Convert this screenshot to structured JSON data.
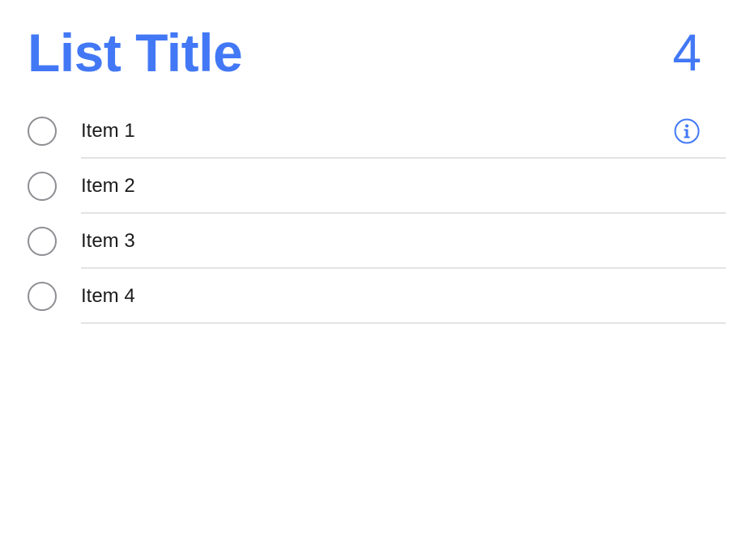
{
  "colors": {
    "accent": "#4278f5",
    "label": "#1c1c1e",
    "checkbox_border": "#8e8e93",
    "divider": "#e3e3e6"
  },
  "header": {
    "title": "List Title",
    "count": "4"
  },
  "items": [
    {
      "label": "Item 1",
      "completed": false,
      "selected": true
    },
    {
      "label": "Item 2",
      "completed": false,
      "selected": false
    },
    {
      "label": "Item 3",
      "completed": false,
      "selected": false
    },
    {
      "label": "Item 4",
      "completed": false,
      "selected": false
    }
  ],
  "icons": {
    "info": "info-circle-icon"
  }
}
